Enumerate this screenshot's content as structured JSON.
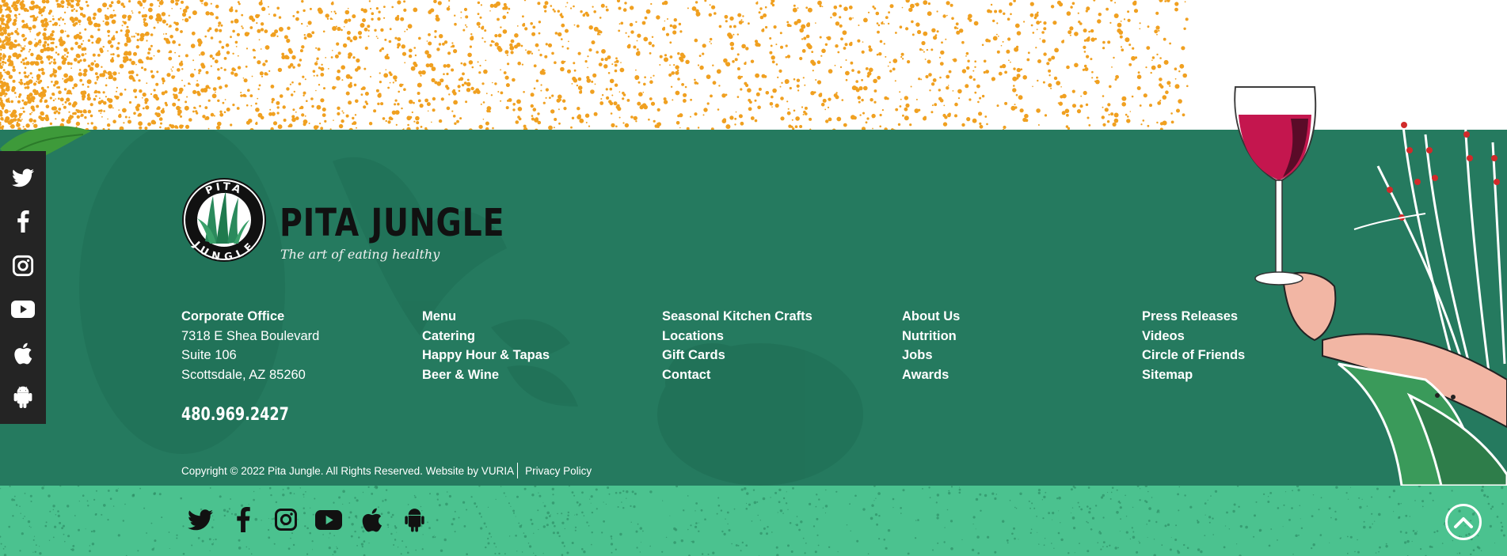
{
  "brand": {
    "name": "PITA JUNGLE",
    "tagline": "The art of eating healthy",
    "badge_top": "PITA",
    "badge_bottom": "JUNGLE"
  },
  "colors": {
    "footer_green": "#257a5f",
    "bottom_bar_green": "#4bc28f",
    "side_bar": "#242424",
    "speckle_orange": "#f0a020"
  },
  "side_social": [
    {
      "icon": "twitter-icon"
    },
    {
      "icon": "facebook-icon"
    },
    {
      "icon": "instagram-icon"
    },
    {
      "icon": "youtube-icon"
    },
    {
      "icon": "apple-icon"
    },
    {
      "icon": "android-icon"
    }
  ],
  "office": {
    "heading": "Corporate Office",
    "address1": "7318 E Shea Boulevard",
    "address2": "Suite 106",
    "city": "Scottsdale, AZ 85260",
    "phone": "480.969.2427"
  },
  "links": {
    "col2": [
      "Menu",
      "Catering",
      "Happy Hour & Tapas",
      "Beer & Wine"
    ],
    "col3": [
      "Seasonal Kitchen Crafts",
      "Locations",
      "Gift Cards",
      "Contact"
    ],
    "col4": [
      "About Us",
      "Nutrition",
      "Jobs",
      "Awards"
    ],
    "col5": [
      "Press Releases",
      "Videos",
      "Circle of Friends",
      "Sitemap"
    ]
  },
  "footer": {
    "copyright": "Copyright © 2022 Pita Jungle. All Rights Reserved. Website by VURIA",
    "privacy": "Privacy Policy"
  },
  "bottom_social": [
    {
      "icon": "twitter-icon"
    },
    {
      "icon": "facebook-icon"
    },
    {
      "icon": "instagram-icon"
    },
    {
      "icon": "youtube-icon"
    },
    {
      "icon": "apple-icon"
    },
    {
      "icon": "android-icon"
    }
  ],
  "back_to_top": {
    "icon": "chevron-up-icon"
  }
}
